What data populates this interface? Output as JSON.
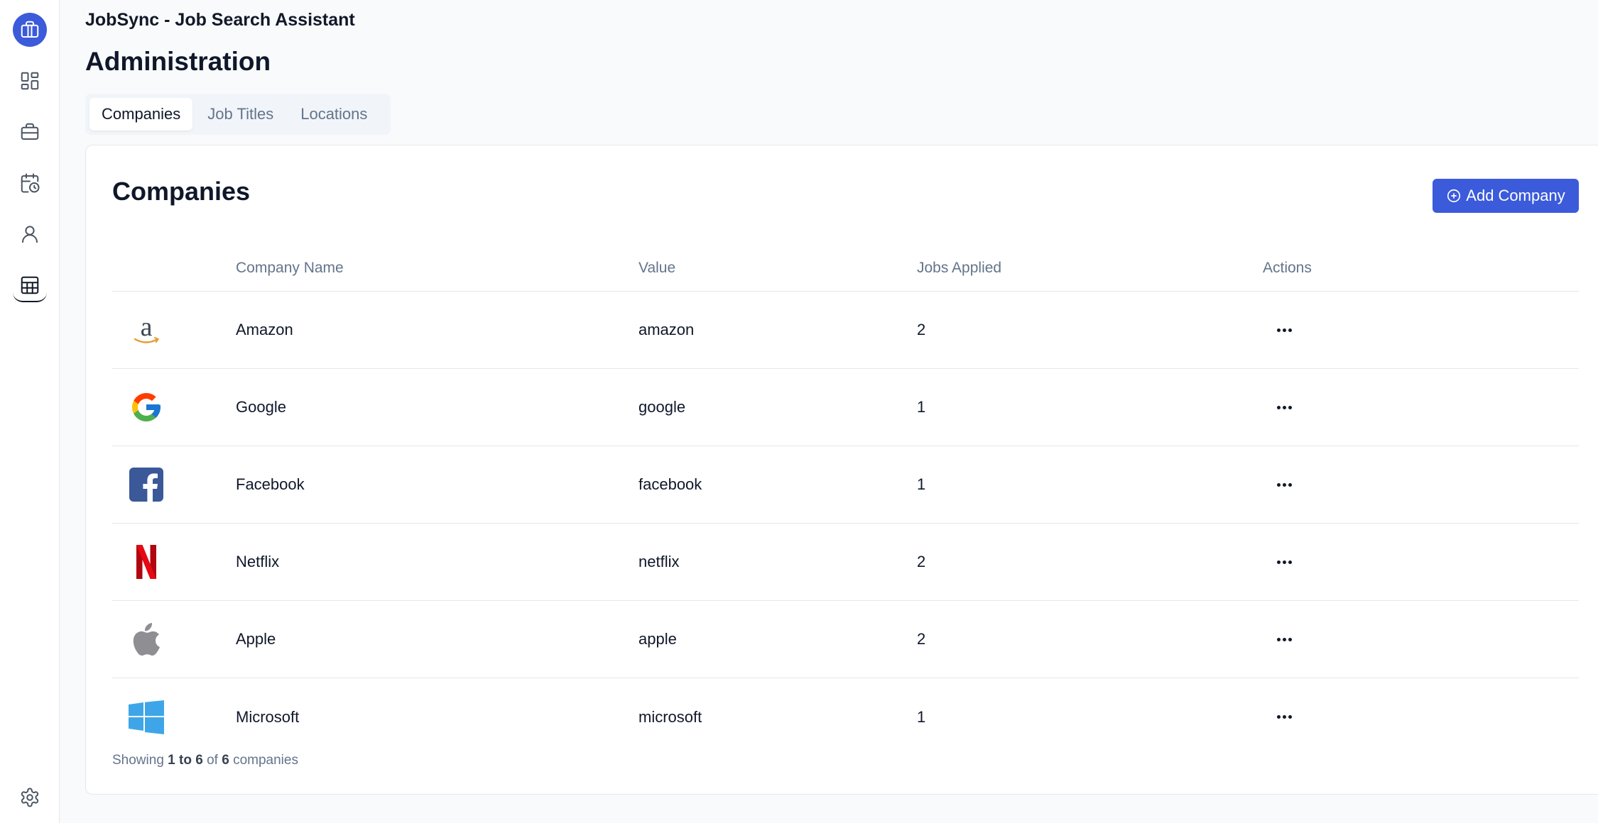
{
  "app": {
    "title": "JobSync - Job Search Assistant"
  },
  "page": {
    "title": "Administration"
  },
  "sidebar": {
    "items": [
      {
        "name": "brand",
        "icon": "briefcase-icon"
      },
      {
        "name": "dashboard",
        "icon": "dashboard-icon"
      },
      {
        "name": "jobs",
        "icon": "briefcase-icon"
      },
      {
        "name": "activities",
        "icon": "calendar-clock-icon"
      },
      {
        "name": "profile",
        "icon": "user-icon"
      },
      {
        "name": "administration",
        "icon": "table-icon",
        "active": true
      },
      {
        "name": "settings",
        "icon": "gear-icon"
      }
    ]
  },
  "tabs": [
    {
      "label": "Companies",
      "active": true
    },
    {
      "label": "Job Titles",
      "active": false
    },
    {
      "label": "Locations",
      "active": false
    }
  ],
  "card": {
    "title": "Companies",
    "add_button_label": "Add Company"
  },
  "table": {
    "headers": {
      "name": "Company Name",
      "value": "Value",
      "jobs": "Jobs Applied",
      "actions": "Actions"
    },
    "rows": [
      {
        "logo": "amazon-logo-icon",
        "name": "Amazon",
        "value": "amazon",
        "jobs": "2"
      },
      {
        "logo": "google-logo-icon",
        "name": "Google",
        "value": "google",
        "jobs": "1"
      },
      {
        "logo": "facebook-logo-icon",
        "name": "Facebook",
        "value": "facebook",
        "jobs": "1"
      },
      {
        "logo": "netflix-logo-icon",
        "name": "Netflix",
        "value": "netflix",
        "jobs": "2"
      },
      {
        "logo": "apple-logo-icon",
        "name": "Apple",
        "value": "apple",
        "jobs": "2"
      },
      {
        "logo": "microsoft-logo-icon",
        "name": "Microsoft",
        "value": "microsoft",
        "jobs": "1"
      }
    ]
  },
  "footer": {
    "prefix": "Showing",
    "range": "1 to 6",
    "of": "of",
    "total": "6",
    "suffix": "companies"
  },
  "colors": {
    "accent": "#3b5bdb",
    "muted_text": "#64748b",
    "border": "#e5e7eb",
    "background": "#f8fafc"
  }
}
